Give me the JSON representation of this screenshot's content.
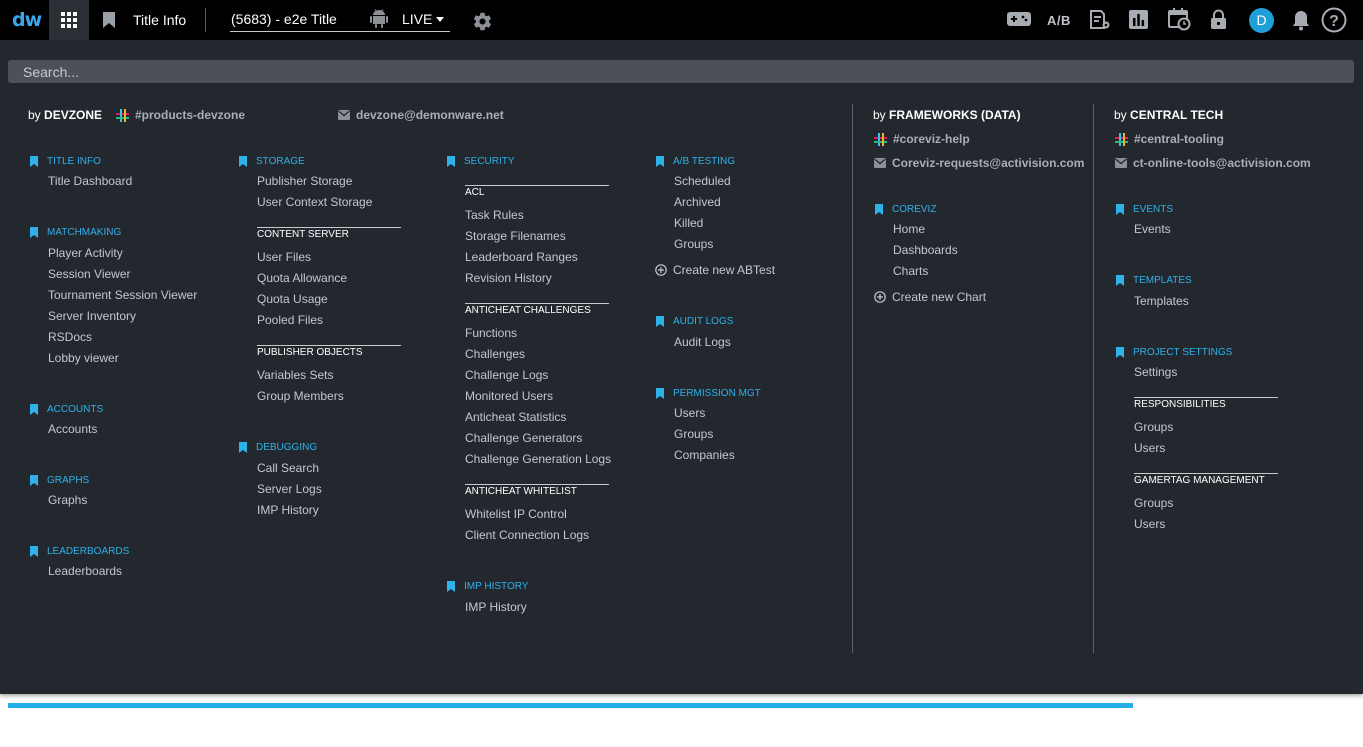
{
  "topbar": {
    "logo": "dw",
    "title_info": "Title Info",
    "title_name": "(5683) - e2e Title",
    "environment": "LIVE",
    "ab_label": "A/B",
    "avatar_initial": "D"
  },
  "search": {
    "placeholder": "Search..."
  },
  "devzone": {
    "by": "by",
    "name": "DEVZONE",
    "slack": "#products-devzone",
    "email": "devzone@demonware.net"
  },
  "frameworks": {
    "by": "by",
    "name": "FRAMEWORKS (DATA)",
    "slack": "#coreviz-help",
    "email": "Coreviz-requests@activision.com"
  },
  "central": {
    "by": "by",
    "name": "CENTRAL TECH",
    "slack": "#central-tooling",
    "email": "ct-online-tools@activision.com"
  },
  "col1": {
    "title_info": {
      "title": "TITLE INFO",
      "items": [
        "Title Dashboard"
      ]
    },
    "matchmaking": {
      "title": "MATCHMAKING",
      "items": [
        "Player Activity",
        "Session Viewer",
        "Tournament Session Viewer",
        "Server Inventory",
        "RSDocs",
        "Lobby viewer"
      ]
    },
    "accounts": {
      "title": "ACCOUNTS",
      "items": [
        "Accounts"
      ]
    },
    "graphs": {
      "title": "GRAPHS",
      "items": [
        "Graphs"
      ]
    },
    "leaderboards": {
      "title": "LEADERBOARDS",
      "items": [
        "Leaderboards"
      ]
    }
  },
  "col2": {
    "storage": {
      "title": "STORAGE",
      "items": [
        "Publisher Storage",
        "User Context Storage"
      ]
    },
    "content_server": {
      "title": "CONTENT SERVER",
      "items": [
        "User Files",
        "Quota Allowance",
        "Quota Usage",
        "Pooled Files"
      ]
    },
    "publisher_objects": {
      "title": "PUBLISHER OBJECTS",
      "items": [
        "Variables Sets",
        "Group Members"
      ]
    },
    "debugging": {
      "title": "DEBUGGING",
      "items": [
        "Call Search",
        "Server Logs",
        "IMP History"
      ]
    }
  },
  "col3": {
    "security": {
      "title": "SECURITY"
    },
    "acl": {
      "title": "ACL",
      "items": [
        "Task Rules",
        "Storage Filenames",
        "Leaderboard Ranges",
        "Revision History"
      ]
    },
    "anticheat_challenges": {
      "title": "ANTICHEAT CHALLENGES",
      "items": [
        "Functions",
        "Challenges",
        "Challenge Logs",
        "Monitored Users",
        "Anticheat Statistics",
        "Challenge Generators",
        "Challenge Generation Logs"
      ]
    },
    "anticheat_whitelist": {
      "title": "ANTICHEAT WHITELIST",
      "items": [
        "Whitelist IP Control",
        "Client Connection Logs"
      ]
    },
    "imp_history": {
      "title": "IMP HISTORY",
      "items": [
        "IMP History"
      ]
    }
  },
  "col4": {
    "ab_testing": {
      "title": "A/B TESTING",
      "items": [
        "Scheduled",
        "Archived",
        "Killed",
        "Groups"
      ],
      "create": "Create new ABTest"
    },
    "audit_logs": {
      "title": "AUDIT LOGS",
      "items": [
        "Audit Logs"
      ]
    },
    "permission_mgt": {
      "title": "PERMISSION MGT",
      "items": [
        "Users",
        "Groups",
        "Companies"
      ]
    }
  },
  "col5": {
    "coreviz": {
      "title": "COREVIZ",
      "items": [
        "Home",
        "Dashboards",
        "Charts"
      ],
      "create": "Create new Chart"
    }
  },
  "col6": {
    "events": {
      "title": "EVENTS",
      "items": [
        "Events"
      ]
    },
    "templates": {
      "title": "TEMPLATES",
      "items": [
        "Templates"
      ]
    },
    "project_settings": {
      "title": "PROJECT SETTINGS",
      "items": [
        "Settings"
      ]
    },
    "responsibilities": {
      "title": "RESPONSIBILITIES",
      "items": [
        "Groups",
        "Users"
      ]
    },
    "gamertag_management": {
      "title": "GAMERTAG MANAGEMENT",
      "items": [
        "Groups",
        "Users"
      ]
    }
  },
  "progress": {
    "fraction": 0.83
  },
  "colors": {
    "accent": "#2fb1ea",
    "panel": "#23272e",
    "topbar": "#000000",
    "avatar": "#1f9fd8"
  }
}
